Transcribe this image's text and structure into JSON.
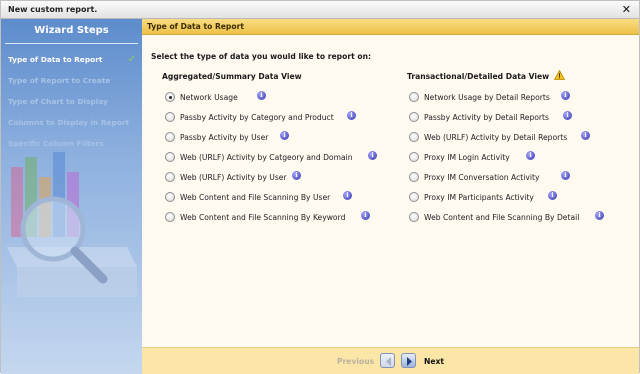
{
  "window": {
    "title": "New custom report."
  },
  "sidebar": {
    "heading": "Wizard Steps",
    "steps": [
      {
        "label": "Type of Data to Report",
        "active": true
      },
      {
        "label": "Type of Report to Create",
        "active": false
      },
      {
        "label": "Type of Chart to Display",
        "active": false
      },
      {
        "label": "Columns to Display in Report",
        "active": false
      },
      {
        "label": "Specific Column Filters",
        "active": false
      }
    ]
  },
  "content": {
    "header": "Type of Data to Report",
    "prompt": "Select the type of data you would like to report on:",
    "aggregated": {
      "title": "Aggregated/Summary Data View",
      "options": [
        {
          "label": "Network Usage",
          "selected": true
        },
        {
          "label": "Passby Activity by Category and Product",
          "selected": false
        },
        {
          "label": "Passby Activity by User",
          "selected": false
        },
        {
          "label": "Web (URLF) Activity by Catgeory and Domain",
          "selected": false
        },
        {
          "label": "Web (URLF) Activity by User",
          "selected": false
        },
        {
          "label": "Web Content and File Scanning By User",
          "selected": false
        },
        {
          "label": "Web Content and File Scanning By Keyword",
          "selected": false
        }
      ]
    },
    "transactional": {
      "title": "Transactional/Detailed Data View",
      "options": [
        {
          "label": "Network Usage by Detail Reports",
          "selected": false
        },
        {
          "label": "Passby Activity by Detail Reports",
          "selected": false
        },
        {
          "label": "Web (URLF) Activity by Detail Reports",
          "selected": false
        },
        {
          "label": "Proxy IM Login Activity",
          "selected": false
        },
        {
          "label": "Proxy IM Conversation Activity",
          "selected": false
        },
        {
          "label": "Proxy IM Participants Activity",
          "selected": false
        },
        {
          "label": "Web Content and File Scanning By Detail",
          "selected": false
        }
      ]
    }
  },
  "footer": {
    "previous_label": "Previous",
    "next_label": "Next"
  },
  "colors": {
    "sidebar": "#7aa0d6",
    "header": "#f2cd62",
    "footer": "#fbe6a7",
    "content": "#fffaf0"
  }
}
